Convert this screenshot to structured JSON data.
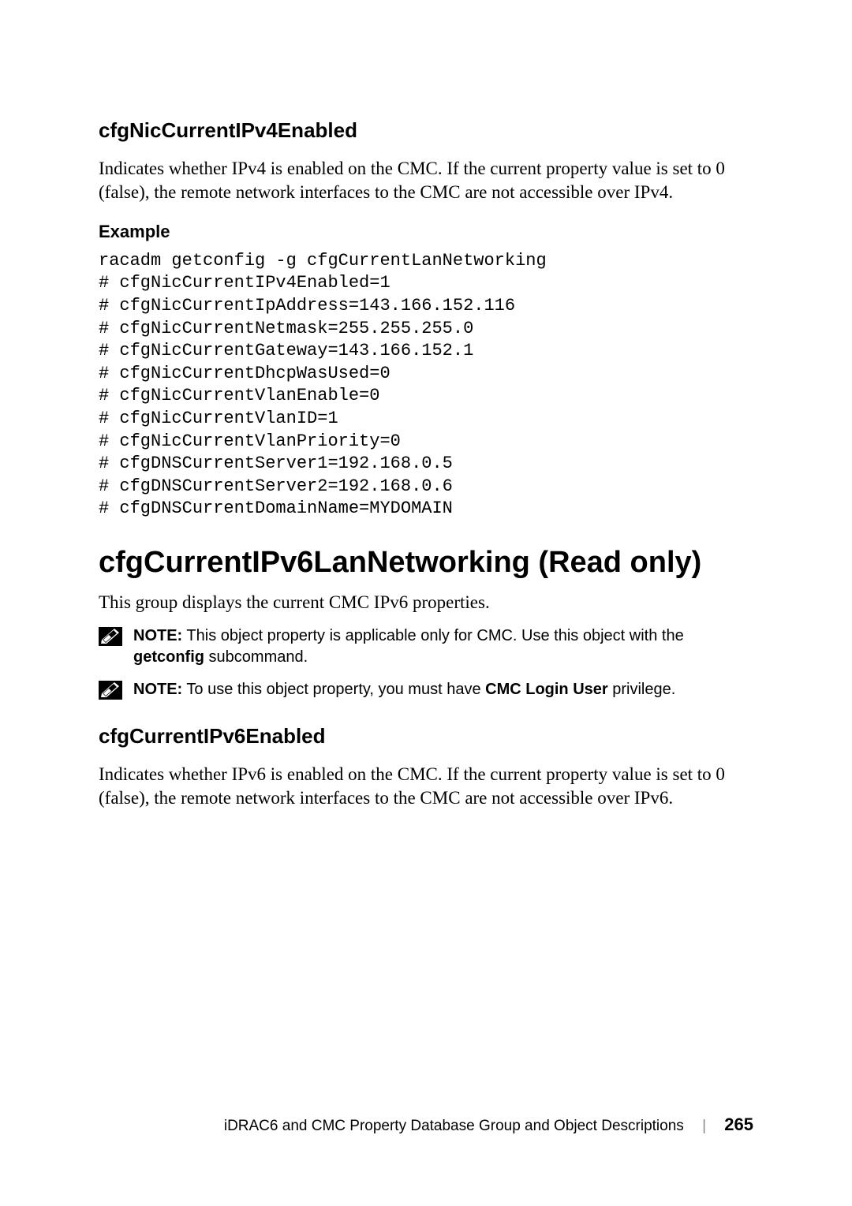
{
  "section1": {
    "heading": "cfgNicCurrentIPv4Enabled",
    "description": "Indicates whether IPv4 is enabled on the CMC. If the current property value is set to 0 (false), the remote network interfaces to the CMC are not accessible over IPv4.",
    "example_label": "Example",
    "code": "racadm getconfig -g cfgCurrentLanNetworking\n# cfgNicCurrentIPv4Enabled=1\n# cfgNicCurrentIpAddress=143.166.152.116\n# cfgNicCurrentNetmask=255.255.255.0\n# cfgNicCurrentGateway=143.166.152.1\n# cfgNicCurrentDhcpWasUsed=0\n# cfgNicCurrentVlanEnable=0\n# cfgNicCurrentVlanID=1\n# cfgNicCurrentVlanPriority=0\n# cfgDNSCurrentServer1=192.168.0.5\n# cfgDNSCurrentServer2=192.168.0.6\n# cfgDNSCurrentDomainName=MYDOMAIN"
  },
  "section2": {
    "heading": "cfgCurrentIPv6LanNetworking (Read only)",
    "description": "This group displays the current CMC IPv6 properties.",
    "note1": {
      "label": "NOTE:",
      "before": " This object property is applicable only for CMC. Use this object with the ",
      "bold": "getconfig",
      "after": " subcommand."
    },
    "note2": {
      "label": "NOTE:",
      "before": " To use this object property, you must have ",
      "bold": "CMC Login User",
      "after": " privilege."
    }
  },
  "section3": {
    "heading": "cfgCurrentIPv6Enabled",
    "description": "Indicates whether IPv6 is enabled on the CMC. If the current property value is set to 0 (false), the remote network interfaces to the CMC are not accessible over IPv6."
  },
  "footer": {
    "title": "iDRAC6 and CMC Property Database Group and Object Descriptions",
    "page": "265"
  }
}
